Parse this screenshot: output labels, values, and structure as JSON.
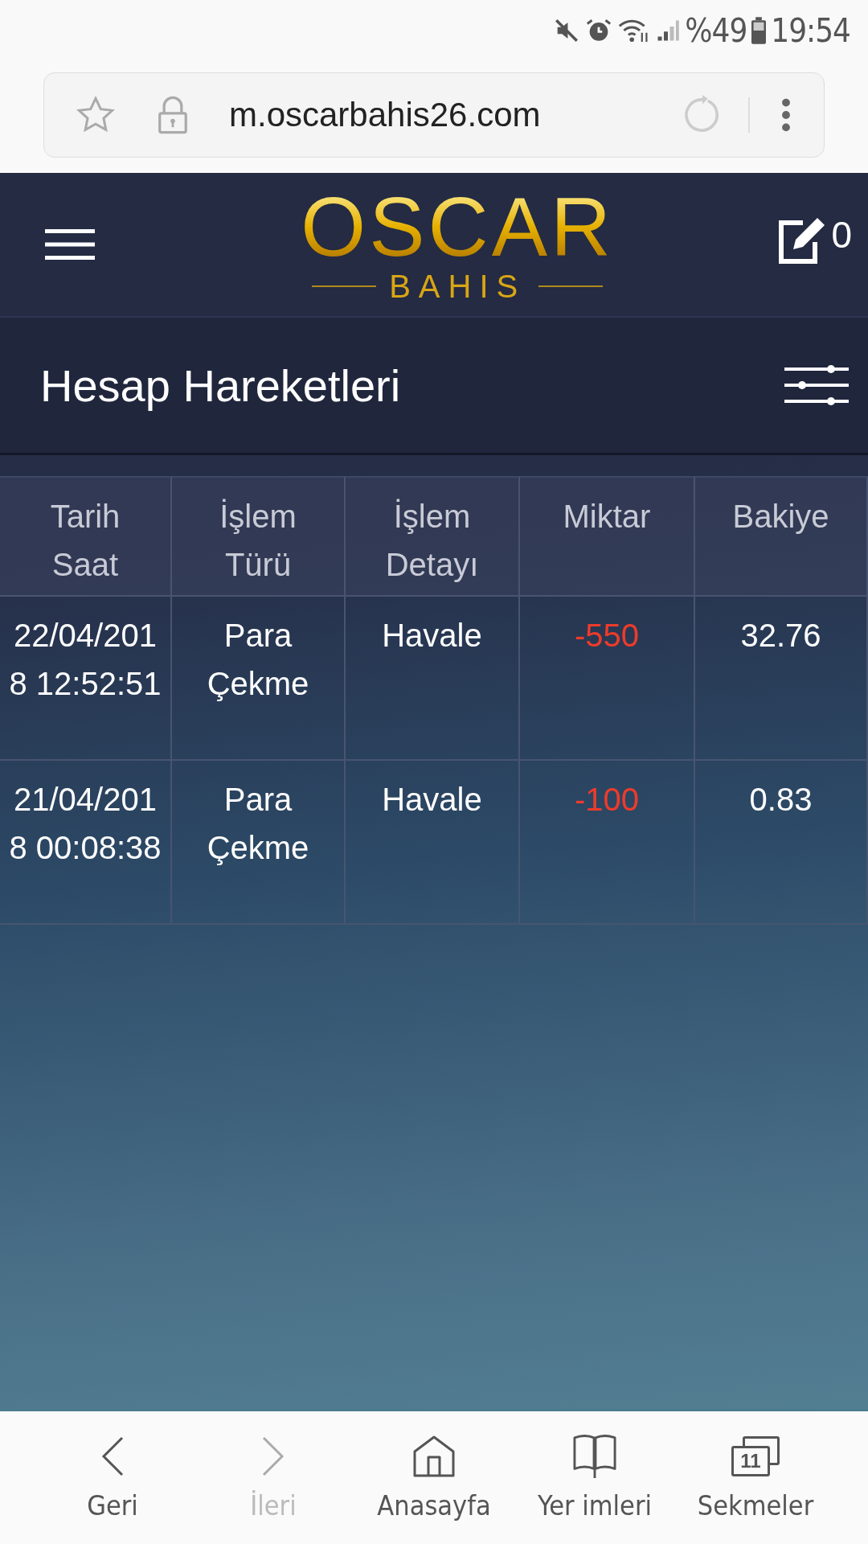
{
  "status_bar": {
    "battery": "%49",
    "time": "19:54"
  },
  "address_bar": {
    "url": "m.oscarbahis26.com"
  },
  "header": {
    "logo_title": "OSCAR",
    "logo_subtitle": "BAHIS",
    "notes_count": "0"
  },
  "page_title": "Hesap Hareketleri",
  "table": {
    "columns": [
      [
        "Tarih",
        "Saat"
      ],
      [
        "İşlem",
        "Türü"
      ],
      [
        "İşlem",
        "Detayı"
      ],
      [
        "Miktar"
      ],
      [
        "Bakiye"
      ]
    ],
    "rows": [
      {
        "date": [
          "22/04/201",
          "8 12:52:51"
        ],
        "type": [
          "Para",
          "Çekme"
        ],
        "detail": "Havale",
        "amount": "-550",
        "color": "#ee3b2b",
        "balance": "32.76"
      },
      {
        "date": [
          "21/04/201",
          "8 00:08:38"
        ],
        "type": [
          "Para",
          "Çekme"
        ],
        "detail": "Havale",
        "amount": "-100",
        "color": "#ee3b2b",
        "balance": "0.83"
      }
    ]
  },
  "bottom_nav": [
    {
      "kind": "back",
      "label": "Geri",
      "disabled": false
    },
    {
      "kind": "forward",
      "label": "İleri",
      "disabled": true
    },
    {
      "kind": "home",
      "label": "Anasayfa",
      "disabled": false
    },
    {
      "kind": "bookmarks",
      "label": "Yer imleri",
      "disabled": false
    },
    {
      "kind": "tabs",
      "label": "Sekmeler",
      "disabled": false,
      "count": "11"
    }
  ]
}
